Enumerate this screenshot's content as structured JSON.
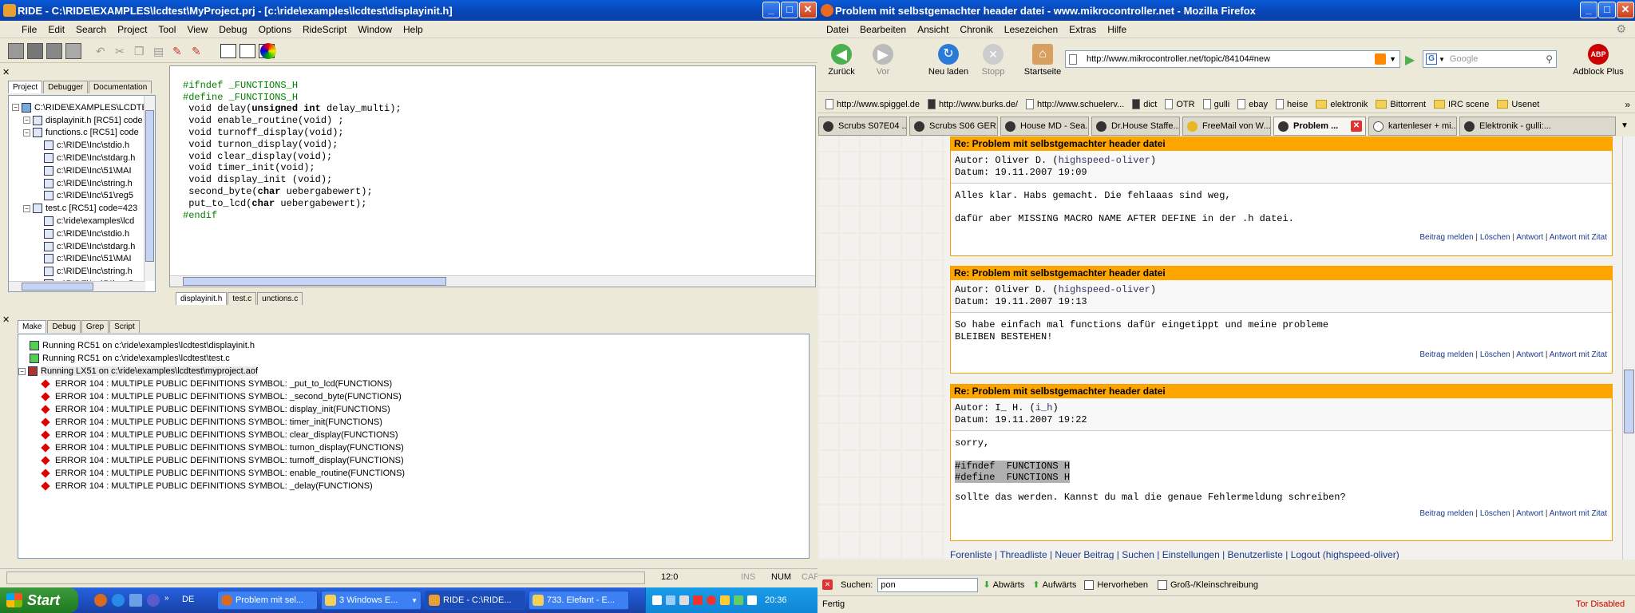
{
  "ride": {
    "title": "RIDE - C:\\RIDE\\EXAMPLES\\lcdtest\\MyProject.prj - [c:\\ride\\examples\\lcdtest\\displayinit.h]",
    "menu": [
      "File",
      "Edit",
      "Search",
      "Project",
      "Tool",
      "View",
      "Debug",
      "Options",
      "RideScript",
      "Window",
      "Help"
    ],
    "project_tabs": [
      "Project",
      "Debugger",
      "Documentation"
    ],
    "tree": [
      "C:\\RIDE\\EXAMPLES\\LCDTES",
      "displayinit.h [RC51] code",
      "functions.c [RC51] code",
      "c:\\RIDE\\Inc\\stdio.h",
      "c:\\RIDE\\Inc\\stdarg.h",
      "c:\\RIDE\\Inc\\51\\MAI",
      "c:\\RIDE\\Inc\\string.h",
      "c:\\RIDE\\Inc\\51\\reg5",
      "test.c [RC51] code=423",
      "c:\\ride\\examples\\lcd",
      "c:\\RIDE\\Inc\\stdio.h",
      "c:\\RIDE\\Inc\\stdarg.h",
      "c:\\RIDE\\Inc\\51\\MAI",
      "c:\\RIDE\\Inc\\string.h",
      "c:\\RIDE\\Inc\\51\\reg5"
    ],
    "code": {
      "l1": "#ifndef _FUNCTIONS_H",
      "l2": "#define _FUNCTIONS_H",
      "l3a": " void delay(",
      "l3b": "unsigned int",
      "l3c": " delay_multi);",
      "l4": " void enable_routine(void) ;",
      "l5": " void turnoff_display(void);",
      "l6": " void turnon_display(void);",
      "l7": " void clear_display(void);",
      "l8": " void timer_init(void);",
      "l9": " void display_init (void);",
      "l10a": " second_byte(",
      "l10b": "char",
      "l10c": " uebergabewert);",
      "l11a": " put_to_lcd(",
      "l11b": "char",
      "l11c": " uebergabewert);",
      "l12": "#endif"
    },
    "editor_tabs": [
      "displayinit.h",
      "test.c",
      "unctions.c"
    ],
    "output_tabs": [
      "Make",
      "Debug",
      "Grep",
      "Script"
    ],
    "log": [
      "Running RC51 on c:\\ride\\examples\\lcdtest\\displayinit.h",
      "Running RC51 on c:\\ride\\examples\\lcdtest\\test.c",
      "Running LX51 on c:\\ride\\examples\\lcdtest\\myproject.aof"
    ],
    "errors": [
      "ERROR 104 : MULTIPLE PUBLIC DEFINITIONS SYMBOL: _put_to_lcd(FUNCTIONS)",
      "ERROR 104 : MULTIPLE PUBLIC DEFINITIONS SYMBOL: _second_byte(FUNCTIONS)",
      "ERROR 104 : MULTIPLE PUBLIC DEFINITIONS SYMBOL: display_init(FUNCTIONS)",
      "ERROR 104 : MULTIPLE PUBLIC DEFINITIONS SYMBOL: timer_init(FUNCTIONS)",
      "ERROR 104 : MULTIPLE PUBLIC DEFINITIONS SYMBOL: clear_display(FUNCTIONS)",
      "ERROR 104 : MULTIPLE PUBLIC DEFINITIONS SYMBOL: turnon_display(FUNCTIONS)",
      "ERROR 104 : MULTIPLE PUBLIC DEFINITIONS SYMBOL: turnoff_display(FUNCTIONS)",
      "ERROR 104 : MULTIPLE PUBLIC DEFINITIONS SYMBOL: enable_routine(FUNCTIONS)",
      "ERROR 104 : MULTIPLE PUBLIC DEFINITIONS SYMBOL: _delay(FUNCTIONS)"
    ],
    "status": {
      "pos": "12:0",
      "ins": "INS",
      "num": "NUM",
      "cap": "CAP"
    }
  },
  "firefox": {
    "title": "Problem mit selbstgemachter header datei - www.mikrocontroller.net - Mozilla Firefox",
    "menu": [
      "Datei",
      "Bearbeiten",
      "Ansicht",
      "Chronik",
      "Lesezeichen",
      "Extras",
      "Hilfe"
    ],
    "nav": {
      "back": "Zurück",
      "forward": "Vor",
      "reload": "Neu laden",
      "stop": "Stopp",
      "home": "Startseite",
      "adblock": "Adblock Plus"
    },
    "url": "http://www.mikrocontroller.net/topic/84104#new",
    "search_placeholder": "Google",
    "bookmarks": [
      "http://www.spiggel.de",
      "http://www.burks.de/",
      "http://www.schuelerv...",
      "dict",
      "OTR",
      "gulli",
      "ebay",
      "heise",
      "elektronik",
      "Bittorrent",
      "IRC scene",
      "Usenet"
    ],
    "tabs": [
      "Scrubs S07E04 ...",
      "Scrubs S06 GER...",
      "House MD - Sea...",
      "Dr.House Staffe...",
      "FreeMail von W...",
      "Problem ...",
      "kartenleser + mi...",
      "Elektronik - gulli:..."
    ],
    "posts": [
      {
        "title": "Re: Problem mit selbstgemachter header datei",
        "author": "Autor: Oliver D. (",
        "handle": "highspeed-oliver",
        "author_end": ")",
        "date": "Datum: 19.11.2007 19:09",
        "body": "Alles klar. Habs gemacht. Die fehlaaas sind weg,\n\ndafür aber MISSING MACRO NAME AFTER DEFINE in der .h datei."
      },
      {
        "title": "Re: Problem mit selbstgemachter header datei",
        "author": "Autor: Oliver D. (",
        "handle": "highspeed-oliver",
        "author_end": ")",
        "date": "Datum: 19.11.2007 19:13",
        "body": "So habe einfach mal functions dafür eingetippt und meine probleme\nBLEIBEN BESTEHEN!"
      },
      {
        "title": "Re: Problem mit selbstgemachter header datei",
        "author": "Autor: I_ H. (",
        "handle": "i_h",
        "author_end": ")",
        "date": "Datum: 19.11.2007 19:22",
        "body1": "sorry,",
        "sel1": "#ifndef  FUNCTIONS H",
        "sel2": "#define  FUNCTIONS H",
        "body2": "sollte das werden. Kannst du mal die genaue Fehlermeldung schreiben?"
      }
    ],
    "actions": [
      "Beitrag melden",
      "Löschen",
      "Antwort",
      "Antwort mit Zitat"
    ],
    "footer_links": "Forenliste | Threadliste | Neuer Beitrag | Suchen | Einstellungen | Benutzerliste | Logout (highspeed-oliver)",
    "find": {
      "label": "Suchen:",
      "value": "pon",
      "down": "Abwärts",
      "up": "Aufwärts",
      "highlight": "Hervorheben",
      "case": "Groß-/Kleinschreibung"
    },
    "status": "Fertig",
    "tor": "Tor Disabled"
  },
  "taskbar": {
    "start": "Start",
    "lang": "DE",
    "tasks": [
      "Problem mit sel...",
      "3 Windows E...",
      "RIDE - C:\\RIDE...",
      "733. Elefant - E..."
    ],
    "clock": "20:36"
  }
}
